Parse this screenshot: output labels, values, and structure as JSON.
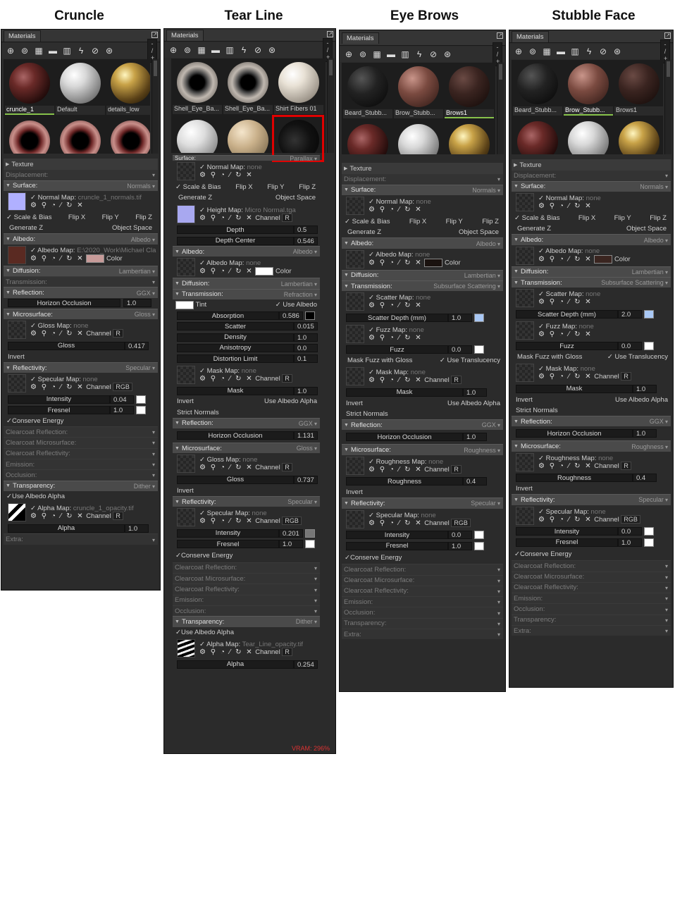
{
  "titles": [
    "Cruncle",
    "Tear Line",
    "Eye Brows",
    "Stubble Face"
  ],
  "common": {
    "tab_label": "Materials",
    "pager": "- / +",
    "icons": [
      "plus-icon",
      "duplicate-icon",
      "checker-icon",
      "folder-icon",
      "trash-icon",
      "eyedropper-icon",
      "refresh-icon",
      "import-icon"
    ],
    "map_tools": [
      "gear-icon",
      "search-icon",
      "fill-icon",
      "brush-icon",
      "reset-icon",
      "close-icon"
    ]
  },
  "p1": {
    "thumbs": [
      "cruncle_1",
      "Default",
      "details_low"
    ],
    "rows": {
      "texture": "Texture",
      "displacement": "Displacement:",
      "surface": "Surface:",
      "surface_r": "Normals",
      "normal_map": "Normal Map:",
      "normal_file": "cruncle_1_normals.tif",
      "scale_bias": "Scale & Bias",
      "flipx": "Flip X",
      "flipy": "Flip Y",
      "flipz": "Flip Z",
      "genz": "Generate Z",
      "objspace": "Object Space",
      "albedo": "Albedo:",
      "albedo_r": "Albedo",
      "albedo_map": "Albedo Map:",
      "albedo_file": "E:\\2020_Work\\Michael Cla",
      "color": "Color",
      "diffusion": "Diffusion:",
      "diffusion_r": "Lambertian",
      "transmission": "Transmission:",
      "reflection": "Reflection:",
      "reflection_r": "GGX",
      "horizon": "Horizon Occlusion",
      "horizon_v": "1.0",
      "micro": "Microsurface:",
      "micro_r": "Gloss",
      "gloss_map": "Gloss Map:",
      "none": "none",
      "channel": "Channel",
      "ch_r": "R",
      "gloss": "Gloss",
      "gloss_v": "0.417",
      "invert": "Invert",
      "reflectivity": "Reflectivity:",
      "reflectivity_r": "Specular",
      "spec_map": "Specular Map:",
      "ch_rgb": "RGB",
      "intensity": "Intensity",
      "intensity_v": "0.04",
      "fresnel": "Fresnel",
      "fresnel_v": "1.0",
      "conserve": "Conserve Energy",
      "cc_refl": "Clearcoat Reflection:",
      "cc_micro": "Clearcoat Microsurface:",
      "cc_reflv": "Clearcoat Reflectivity:",
      "emission": "Emission:",
      "occlusion": "Occlusion:",
      "transparency": "Transparency:",
      "transparency_r": "Dither",
      "use_albedo_alpha": "Use Albedo Alpha",
      "alpha_map": "Alpha Map:",
      "alpha_file": "cruncle_1_opacity.tif",
      "alpha": "Alpha",
      "alpha_v": "1.0",
      "extra": "Extra:"
    }
  },
  "p2": {
    "thumbs": [
      "Shell_Eye_Ba...",
      "Shell_Eye_Ba...",
      "Shirt Fibers 01"
    ],
    "rows": {
      "surface": "Surface:",
      "surface_r": "Parallax",
      "normal_map": "Normal Map:",
      "none": "none",
      "scale_bias": "Scale & Bias",
      "flipx": "Flip X",
      "flipy": "Flip Y",
      "flipz": "Flip Z",
      "genz": "Generate Z",
      "objspace": "Object Space",
      "height_map": "Height Map:",
      "height_file": "Micro Normal.tga",
      "channel": "Channel",
      "ch_r": "R",
      "depth": "Depth",
      "depth_v": "0.5",
      "depth_center": "Depth Center",
      "depth_center_v": "0.546",
      "albedo": "Albedo:",
      "albedo_r": "Albedo",
      "albedo_map": "Albedo Map:",
      "color": "Color",
      "diffusion": "Diffusion:",
      "diffusion_r": "Lambertian",
      "transmission": "Transmission:",
      "transmission_r": "Refraction",
      "tint": "Tint",
      "use_albedo": "Use Albedo",
      "absorption": "Absorption",
      "absorption_v": "0.586",
      "scatter": "Scatter",
      "scatter_v": "0.015",
      "density": "Density",
      "density_v": "1.0",
      "anisotropy": "Anisotropy",
      "anisotropy_v": "0.0",
      "distortion": "Distortion Limit",
      "distortion_v": "0.1",
      "mask_map": "Mask Map:",
      "mask": "Mask",
      "mask_v": "1.0",
      "invert": "Invert",
      "use_albedo_alpha": "Use Albedo Alpha",
      "strict": "Strict Normals",
      "reflection": "Reflection:",
      "reflection_r": "GGX",
      "horizon": "Horizon Occlusion",
      "horizon_v": "1.131",
      "micro": "Microsurface:",
      "micro_r": "Gloss",
      "gloss_map": "Gloss Map:",
      "gloss": "Gloss",
      "gloss_v": "0.737",
      "reflectivity": "Reflectivity:",
      "reflectivity_r": "Specular",
      "spec_map": "Specular Map:",
      "ch_rgb": "RGB",
      "intensity": "Intensity",
      "intensity_v": "0.201",
      "fresnel": "Fresnel",
      "fresnel_v": "1.0",
      "conserve": "Conserve Energy",
      "cc_refl": "Clearcoat Reflection:",
      "cc_micro": "Clearcoat Microsurface:",
      "cc_reflv": "Clearcoat Reflectivity:",
      "emission": "Emission:",
      "occlusion": "Occlusion:",
      "transparency": "Transparency:",
      "transparency_r": "Dither",
      "alpha_map": "Alpha Map:",
      "alpha_file": "Tear_Line_opacity.tif",
      "alpha": "Alpha",
      "alpha_v": "0.254",
      "vram": "VRAM: 296%"
    }
  },
  "p3": {
    "thumbs": [
      "Beard_Stubb...",
      "Brow_Stubb...",
      "Brows1"
    ],
    "rows": {
      "texture": "Texture",
      "displacement": "Displacement:",
      "surface": "Surface:",
      "surface_r": "Normals",
      "normal_map": "Normal Map:",
      "none": "none",
      "scale_bias": "Scale & Bias",
      "flipx": "Flip X",
      "flipy": "Flip Y",
      "flipz": "Flip Z",
      "genz": "Generate Z",
      "objspace": "Object Space",
      "albedo": "Albedo:",
      "albedo_r": "Albedo",
      "albedo_map": "Albedo Map:",
      "color": "Color",
      "diffusion": "Diffusion:",
      "diffusion_r": "Lambertian",
      "transmission": "Transmission:",
      "transmission_r": "Subsurface Scattering",
      "scatter_map": "Scatter Map:",
      "scatter_depth": "Scatter Depth (mm)",
      "scatter_depth_v": "1.0",
      "fuzz_map": "Fuzz Map:",
      "fuzz": "Fuzz",
      "fuzz_v": "0.0",
      "mask_fuzz": "Mask Fuzz with Gloss",
      "use_transl": "Use Translucency",
      "mask_map": "Mask Map:",
      "channel": "Channel",
      "ch_r": "R",
      "mask": "Mask",
      "mask_v": "1.0",
      "invert": "Invert",
      "use_albedo_alpha": "Use Albedo Alpha",
      "strict": "Strict Normals",
      "reflection": "Reflection:",
      "reflection_r": "GGX",
      "horizon": "Horizon Occlusion",
      "horizon_v": "1.0",
      "micro": "Microsurface:",
      "micro_r": "Roughness",
      "rough_map": "Roughness Map:",
      "roughness": "Roughness",
      "roughness_v": "0.4",
      "reflectivity": "Reflectivity:",
      "reflectivity_r": "Specular",
      "spec_map": "Specular Map:",
      "ch_rgb": "RGB",
      "intensity": "Intensity",
      "intensity_v": "0.0",
      "fresnel": "Fresnel",
      "fresnel_v": "1.0",
      "conserve": "Conserve Energy",
      "cc_refl": "Clearcoat Reflection:",
      "cc_micro": "Clearcoat Microsurface:",
      "cc_reflv": "Clearcoat Reflectivity:",
      "emission": "Emission:",
      "occlusion": "Occlusion:",
      "transparency": "Transparency:",
      "extra": "Extra:"
    }
  },
  "p4": {
    "thumbs": [
      "Beard_Stubb...",
      "Brow_Stubb...",
      "Brows1"
    ],
    "rows": {
      "texture": "Texture",
      "displacement": "Displacement:",
      "surface": "Surface:",
      "surface_r": "Normals",
      "normal_map": "Normal Map:",
      "none": "none",
      "scale_bias": "Scale & Bias",
      "flipx": "Flip X",
      "flipy": "Flip Y",
      "flipz": "Flip Z",
      "genz": "Generate Z",
      "objspace": "Object Space",
      "albedo": "Albedo:",
      "albedo_r": "Albedo",
      "albedo_map": "Albedo Map:",
      "color": "Color",
      "diffusion": "Diffusion:",
      "diffusion_r": "Lambertian",
      "transmission": "Transmission:",
      "transmission_r": "Subsurface Scattering",
      "scatter_map": "Scatter Map:",
      "scatter_depth": "Scatter Depth (mm)",
      "scatter_depth_v": "2.0",
      "fuzz_map": "Fuzz Map:",
      "fuzz": "Fuzz",
      "fuzz_v": "0.0",
      "mask_fuzz": "Mask Fuzz with Gloss",
      "use_transl": "Use Translucency",
      "mask_map": "Mask Map:",
      "channel": "Channel",
      "ch_r": "R",
      "mask": "Mask",
      "mask_v": "1.0",
      "invert": "Invert",
      "use_albedo_alpha": "Use Albedo Alpha",
      "strict": "Strict Normals",
      "reflection": "Reflection:",
      "reflection_r": "GGX",
      "horizon": "Horizon Occlusion",
      "horizon_v": "1.0",
      "micro": "Microsurface:",
      "micro_r": "Roughness",
      "rough_map": "Roughness Map:",
      "roughness": "Roughness",
      "roughness_v": "0.4",
      "reflectivity": "Reflectivity:",
      "reflectivity_r": "Specular",
      "spec_map": "Specular Map:",
      "ch_rgb": "RGB",
      "intensity": "Intensity",
      "intensity_v": "0.0",
      "fresnel": "Fresnel",
      "fresnel_v": "1.0",
      "conserve": "Conserve Energy",
      "cc_refl": "Clearcoat Reflection:",
      "cc_micro": "Clearcoat Microsurface:",
      "cc_reflv": "Clearcoat Reflectivity:",
      "emission": "Emission:",
      "occlusion": "Occlusion:",
      "transparency": "Transparency:",
      "extra": "Extra:"
    }
  }
}
